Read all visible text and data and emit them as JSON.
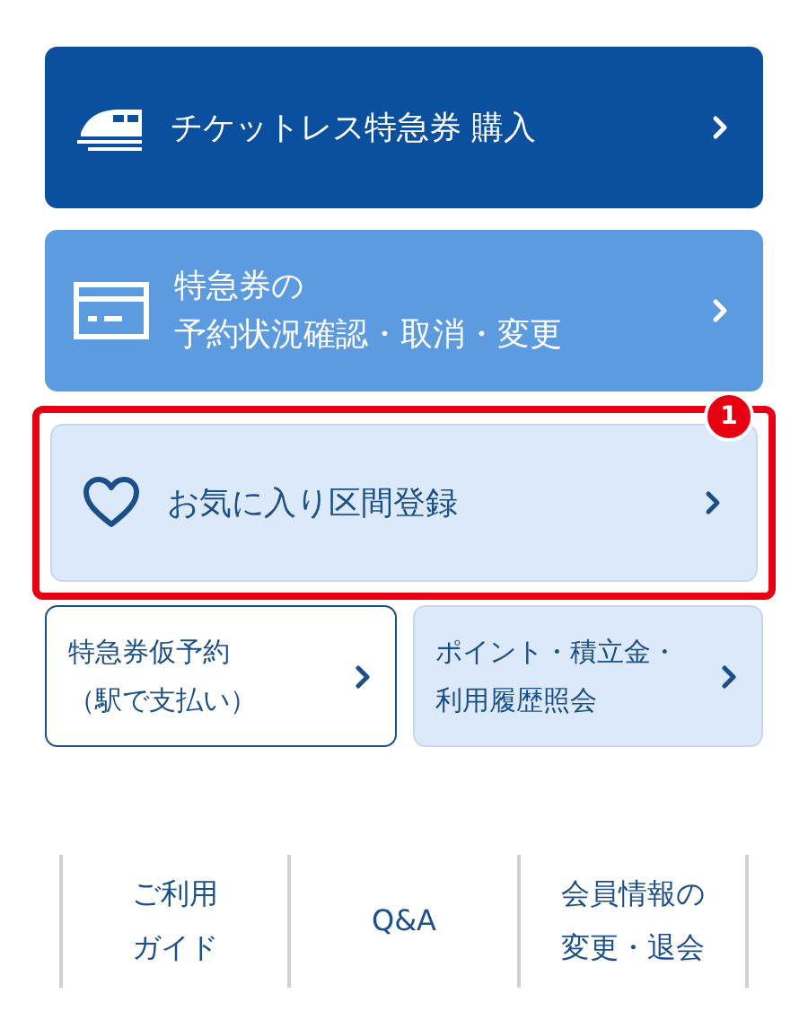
{
  "menu": [
    {
      "kind": "primary",
      "lines": [
        "チケットレス特急券 購入"
      ]
    },
    {
      "kind": "secondary",
      "lines": [
        "特急券の",
        "予約状況確認・取消・変更"
      ]
    },
    {
      "kind": "favorite",
      "lines": [
        "お気に入り区間登録"
      ],
      "highlighted": true,
      "badge": "1"
    }
  ],
  "small_buttons": [
    {
      "kind": "outline",
      "lines": [
        "特急券仮予約",
        "（駅で支払い）"
      ]
    },
    {
      "kind": "light",
      "lines": [
        "ポイント・積立金・",
        "利用履歴照会"
      ]
    }
  ],
  "footer_links": [
    {
      "lines": [
        "ご利用",
        "ガイド"
      ]
    },
    {
      "lines": [
        "Q&A"
      ]
    },
    {
      "lines": [
        "会員情報の",
        "変更・退会"
      ]
    }
  ]
}
